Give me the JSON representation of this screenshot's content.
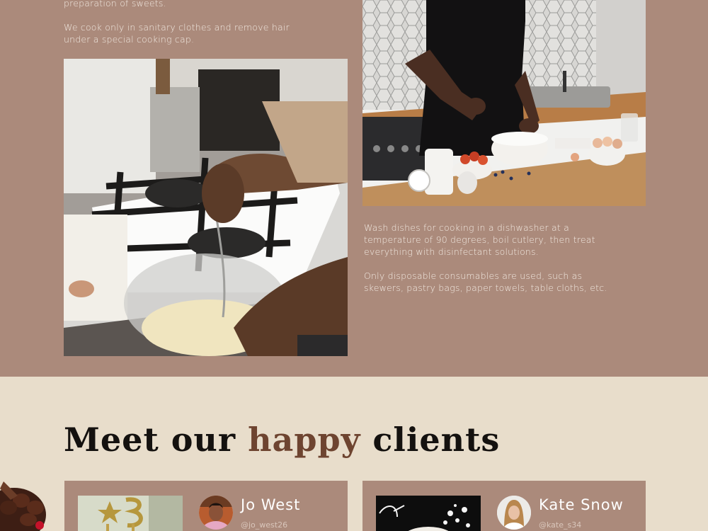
{
  "hygiene": {
    "left_paragraphs": [
      "preparation of sweets.",
      "We cook only in sanitary clothes and remove hair under a special cooking cap."
    ],
    "right_paragraphs": [
      "Wash dishes for cooking in a dishwasher at a temperature of 90 degrees, boil cutlery, then treat everything with disinfectant solutions.",
      "Only disposable consumables are used, such as skewers, pastry bags, paper towels, table cloths, etc."
    ]
  },
  "clients": {
    "heading_pre": "Meet our",
    "heading_accent": "happy",
    "heading_post": "clients",
    "cards": [
      {
        "name": "Jo West",
        "handle": "@jo_west26"
      },
      {
        "name": "Kate Snow",
        "handle": "@kate_s34"
      }
    ]
  },
  "colors": {
    "section_bg": "#ab8a7b",
    "page_bg": "#e8ddcb",
    "accent": "#6e4430"
  }
}
